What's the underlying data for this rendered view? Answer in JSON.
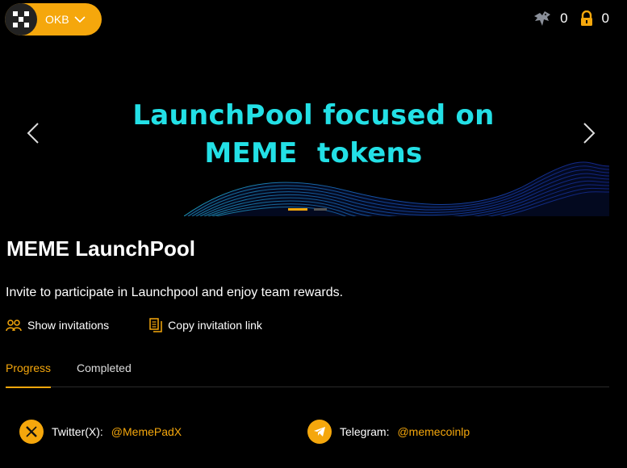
{
  "header": {
    "token": {
      "name": "OKB",
      "icon": "okx-logo-icon",
      "dropdown_icon": "chevron-down-icon"
    },
    "stats": [
      {
        "icon": "eagle-icon",
        "value": "0"
      },
      {
        "icon": "lock-icon",
        "value": "0"
      }
    ]
  },
  "banner": {
    "title_line1": "LaunchPool focused on",
    "title_line2": "MEME  tokens",
    "slides": 2,
    "active_slide": 1,
    "accent_color": "#23e0e6"
  },
  "main": {
    "title": "MEME LaunchPool",
    "description": "Invite to participate in Launchpool and enjoy team rewards.",
    "actions": [
      {
        "label": "Show invitations",
        "icon": "users-icon"
      },
      {
        "label": "Copy invitation link",
        "icon": "copy-icon"
      }
    ],
    "tabs": [
      {
        "label": "Progress",
        "active": true
      },
      {
        "label": "Completed",
        "active": false
      }
    ],
    "socials": [
      {
        "label": "Twitter(X):",
        "handle": "@MemePadX",
        "icon": "x-logo-icon"
      },
      {
        "label": "Telegram:",
        "handle": "@memecoinlp",
        "icon": "telegram-icon"
      }
    ]
  },
  "theme": {
    "accent": "#f5a70c",
    "background": "#000000"
  }
}
